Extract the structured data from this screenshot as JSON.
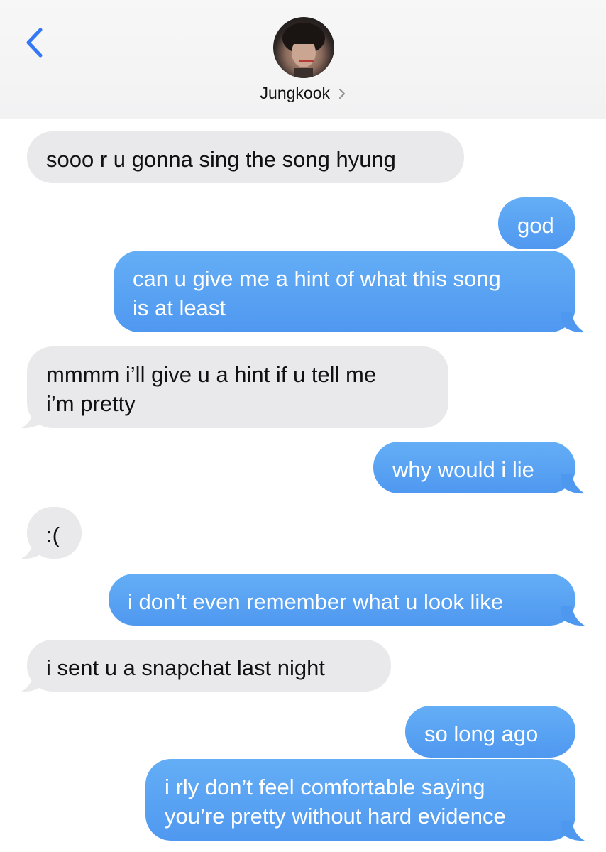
{
  "header": {
    "contact_name": "Jungkook"
  },
  "messages": [
    {
      "side": "in",
      "text": "sooo r u gonna sing the song hyung"
    },
    {
      "side": "out",
      "text": "god"
    },
    {
      "side": "out",
      "line1": "can u give me a hint of what this song",
      "line2": "is at least"
    },
    {
      "side": "in",
      "line1": "mmmm i’ll give u a hint if u tell me",
      "line2": "i’m pretty"
    },
    {
      "side": "out",
      "text": "why would i lie"
    },
    {
      "side": "in",
      "text": ":("
    },
    {
      "side": "out",
      "text": "i don’t even remember what u look like"
    },
    {
      "side": "in",
      "text": "i sent u a snapchat last night"
    },
    {
      "side": "out",
      "text": "so long ago"
    },
    {
      "side": "out",
      "line1": "i rly don’t feel comfortable saying",
      "line2": "you’re pretty without hard evidence"
    }
  ],
  "colors": {
    "incoming_bubble": "#e9e9eb",
    "outgoing_bubble": "#5aa3f4",
    "accent": "#3478f6"
  },
  "icons": {
    "back": "chevron-left-icon",
    "details": "chevron-right-icon"
  }
}
